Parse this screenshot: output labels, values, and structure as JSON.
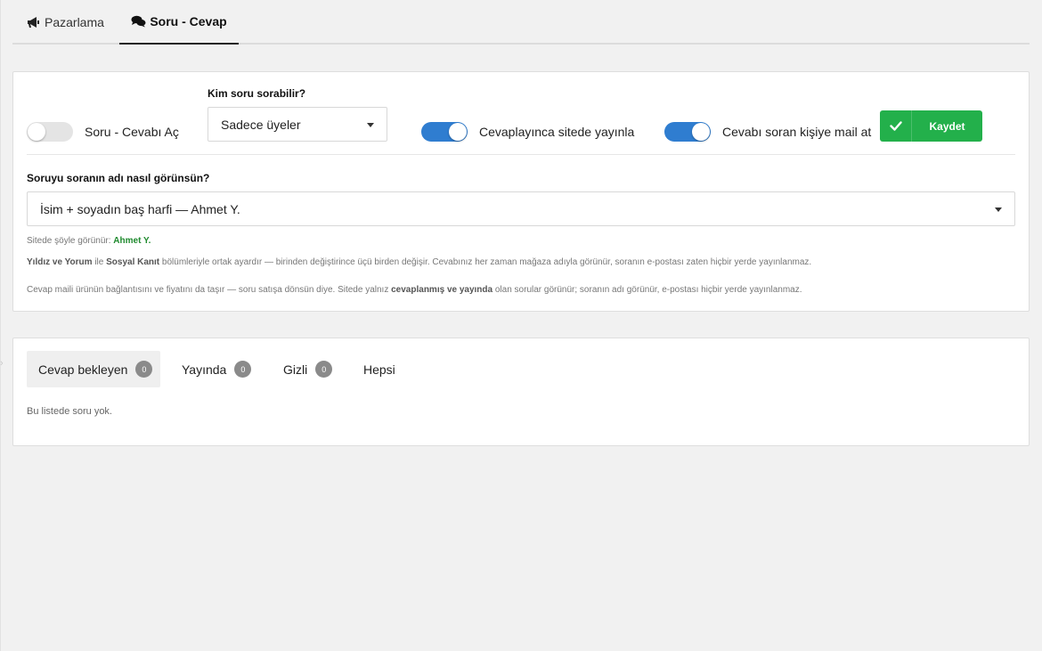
{
  "tabs": {
    "marketing": "Pazarlama",
    "qa": "Soru - Cevap"
  },
  "settings": {
    "enable_toggle": {
      "label": "Soru - Cevabı Aç",
      "on": false
    },
    "who_can_ask": {
      "label": "Kim soru sorabilir?",
      "value": "Sadece üyeler"
    },
    "publish_toggle": {
      "label": "Cevaplayınca sitede yayınla",
      "on": true
    },
    "mail_toggle": {
      "label": "Cevabı soran kişiye mail at",
      "on": true
    },
    "save_label": "Kaydet",
    "name_display": {
      "label": "Soruyu soranın adı nasıl görünsün?",
      "value": "İsim + soyadın baş harfi — Ahmet Y."
    },
    "preview_prefix": "Sitede şöyle görünür:",
    "preview_value": "Ahmet Y.",
    "note1": {
      "b1": "Yıldız ve Yorum",
      "t1": " ile ",
      "b2": "Sosyal Kanıt",
      "t2": " bölümleriyle ortak ayardır — birinden değiştirince üçü birden değişir. Cevabınız her zaman mağaza adıyla görünür, soranın e-postası zaten hiçbir yerde yayınlanmaz."
    },
    "note2": {
      "t1": "Cevap maili ürünün bağlantısını ve fiyatını da taşır — soru satışa dönsün diye. Sitede yalnız ",
      "b1": "cevaplanmış ve yayında",
      "t2": " olan sorular görünür; soranın adı görünür, e-postası hiçbir yerde yayınlanmaz."
    }
  },
  "list": {
    "tabs": [
      {
        "label": "Cevap bekleyen",
        "count": "0"
      },
      {
        "label": "Yayında",
        "count": "0"
      },
      {
        "label": "Gizli",
        "count": "0"
      },
      {
        "label": "Hepsi"
      }
    ],
    "empty": "Bu listede soru yok."
  },
  "colors": {
    "accent_blue": "#2f7dd0",
    "save_green": "#23b04b",
    "preview_green": "#1f8a2e"
  },
  "icons": {
    "marketing_tab": "megaphone-icon",
    "qa_tab": "comments-icon",
    "save": "check-icon"
  }
}
